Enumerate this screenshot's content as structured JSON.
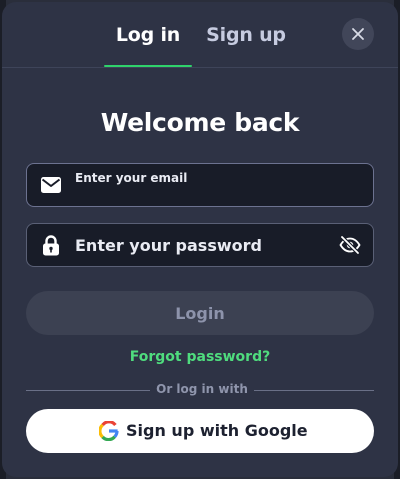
{
  "tabs": [
    {
      "label": "Log in",
      "active": true
    },
    {
      "label": "Sign up",
      "active": false
    }
  ],
  "close_icon": "close-icon",
  "heading": "Welcome back",
  "email": {
    "placeholder": "Enter your email",
    "value": "",
    "icon": "envelope-icon"
  },
  "password": {
    "placeholder": "Enter your password",
    "value": "",
    "icon": "lock-icon",
    "toggle_icon": "eye-off-icon"
  },
  "login_button": "Login",
  "forgot_password": "Forgot password?",
  "divider_text": "Or log in with",
  "google_button": {
    "label": "Sign up with Google",
    "icon": "google-icon"
  },
  "colors": {
    "accent": "#2fd36b",
    "link": "#4fdc7e",
    "modal_bg": "#2e3345",
    "input_bg": "#181c28"
  }
}
